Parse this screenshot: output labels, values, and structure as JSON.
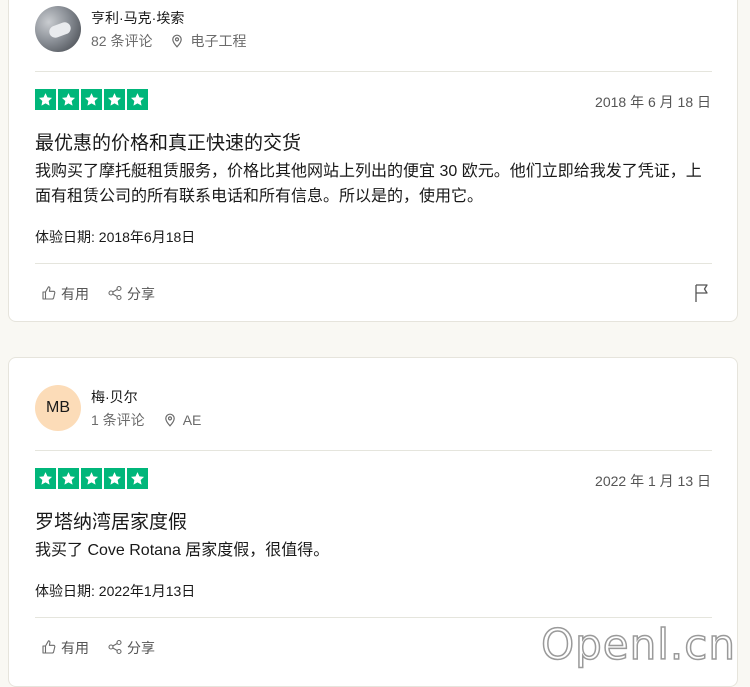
{
  "reviews": [
    {
      "reviewer_name": "亨利·马克·埃索",
      "review_count": "82 条评论",
      "location": "电子工程",
      "rating": 5,
      "date": "2018 年 6 月 18 日",
      "title": "最优惠的价格和真正快速的交货",
      "body": "我购买了摩托艇租赁服务，价格比其他网站上列出的便宜 30 欧元。他们立即给我发了凭证，上面有租赁公司的所有联系电话和所有信息。所以是的，使用它。",
      "experience_date": "体验日期: 2018年6月18日",
      "helpful_label": "有用",
      "share_label": "分享"
    },
    {
      "avatar_initials": "MB",
      "reviewer_name": "梅·贝尔",
      "review_count": "1 条评论",
      "location": "AE",
      "rating": 5,
      "date": "2022 年 1 月 13 日",
      "title": "罗塔纳湾居家度假",
      "body": "我买了 Cove Rotana 居家度假，很值得。",
      "experience_date": "体验日期: 2022年1月13日",
      "helpful_label": "有用",
      "share_label": "分享"
    }
  ],
  "colors": {
    "star_green": "#00b67a",
    "avatar_peach": "#fcdcb8",
    "page_background": "#f9f8f3"
  },
  "watermark": "Openl.cn"
}
